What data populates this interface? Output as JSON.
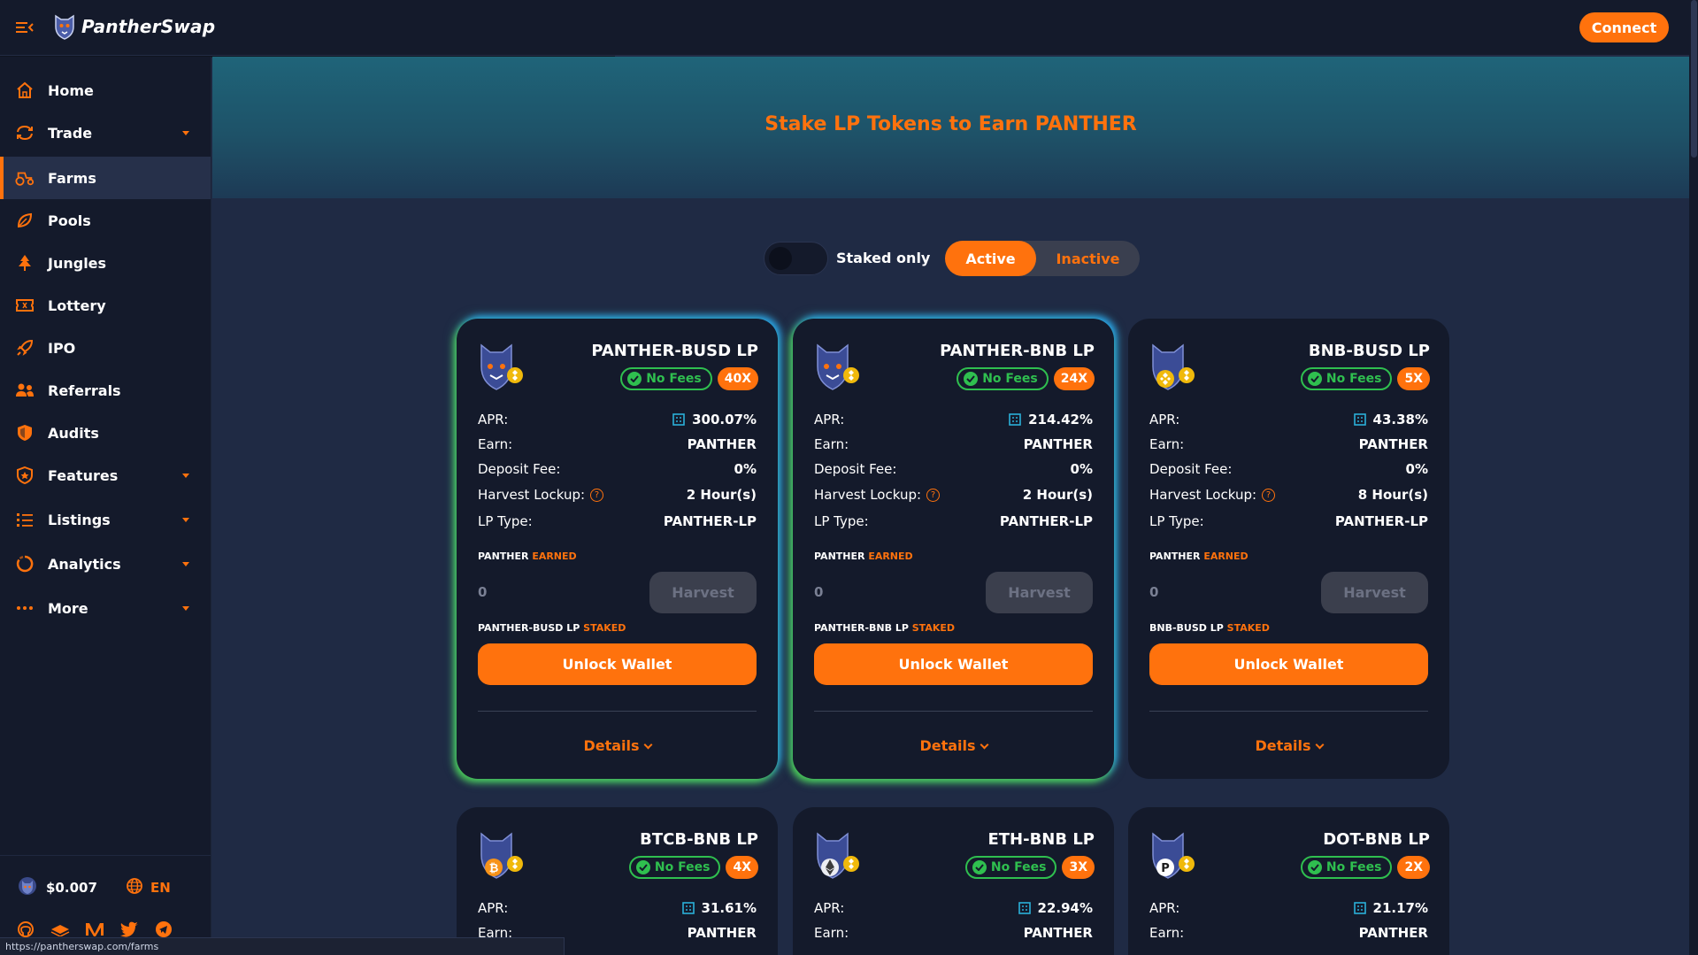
{
  "app": {
    "brand": "PantherSwap",
    "connect_label": "Connect"
  },
  "sidebar": {
    "items": [
      {
        "label": "Home",
        "icon": "home-icon"
      },
      {
        "label": "Trade",
        "icon": "trade-icon",
        "has_submenu": true
      },
      {
        "label": "Farms",
        "icon": "farms-icon",
        "active": true
      },
      {
        "label": "Pools",
        "icon": "pools-icon"
      },
      {
        "label": "Jungles",
        "icon": "jungles-icon"
      },
      {
        "label": "Lottery",
        "icon": "lottery-icon"
      },
      {
        "label": "IPO",
        "icon": "rocket-icon"
      },
      {
        "label": "Referrals",
        "icon": "referrals-icon"
      },
      {
        "label": "Audits",
        "icon": "shield-icon"
      },
      {
        "label": "Features",
        "icon": "features-icon",
        "has_submenu": true
      },
      {
        "label": "Listings",
        "icon": "list-icon",
        "has_submenu": true
      },
      {
        "label": "Analytics",
        "icon": "analytics-icon",
        "has_submenu": true
      },
      {
        "label": "More",
        "icon": "more-icon",
        "has_submenu": true
      }
    ],
    "footer": {
      "price": "$0.007",
      "language": "EN",
      "socials": [
        "github-icon",
        "gitbook-icon",
        "medium-icon",
        "twitter-icon",
        "telegram-icon"
      ]
    }
  },
  "hero": {
    "title": "Stake LP Tokens to Earn PANTHER"
  },
  "filters": {
    "staked_only_label": "Staked only",
    "staked_only": false,
    "active_label": "Active",
    "inactive_label": "Inactive",
    "selected": "Active"
  },
  "labels": {
    "apr": "APR:",
    "earn": "Earn:",
    "deposit_fee": "Deposit Fee:",
    "harvest_lockup": "Harvest Lockup:",
    "lp_type": "LP Type:",
    "earned_token": "PANTHER",
    "earned_word": "EARNED",
    "staked_word": "STAKED",
    "harvest": "Harvest",
    "unlock_wallet": "Unlock Wallet",
    "details": "Details",
    "no_fees": "No Fees"
  },
  "farms": [
    {
      "title": "PANTHER-BUSD LP",
      "multiplier": "40X",
      "apr": "300.07%",
      "earn": "PANTHER",
      "deposit_fee": "0%",
      "harvest_lockup": "2 Hour(s)",
      "lp_type": "PANTHER-LP",
      "earned": "0",
      "staked_label": "PANTHER-BUSD LP",
      "glow": true,
      "quote": "busd"
    },
    {
      "title": "PANTHER-BNB LP",
      "multiplier": "24X",
      "apr": "214.42%",
      "earn": "PANTHER",
      "deposit_fee": "0%",
      "harvest_lockup": "2 Hour(s)",
      "lp_type": "PANTHER-LP",
      "earned": "0",
      "staked_label": "PANTHER-BNB LP",
      "glow": true,
      "quote": "bnb"
    },
    {
      "title": "BNB-BUSD LP",
      "multiplier": "5X",
      "apr": "43.38%",
      "earn": "PANTHER",
      "deposit_fee": "0%",
      "harvest_lockup": "8 Hour(s)",
      "lp_type": "PANTHER-LP",
      "earned": "0",
      "staked_label": "BNB-BUSD LP",
      "glow": false,
      "quote": "bnb"
    },
    {
      "title": "BTCB-BNB LP",
      "multiplier": "4X",
      "apr": "31.61%",
      "earn": "PANTHER",
      "glow": false,
      "quote": "btc"
    },
    {
      "title": "ETH-BNB LP",
      "multiplier": "3X",
      "apr": "22.94%",
      "earn": "PANTHER",
      "glow": false,
      "quote": "eth"
    },
    {
      "title": "DOT-BNB LP",
      "multiplier": "2X",
      "apr": "21.17%",
      "earn": "PANTHER",
      "glow": false,
      "quote": "dot"
    }
  ],
  "status_url": "https://pantherswap.com/farms",
  "colors": {
    "accent": "#ff720d",
    "sidebar_bg": "#141a2b",
    "page_bg": "#1f2a44",
    "green": "#2fbf4f"
  }
}
